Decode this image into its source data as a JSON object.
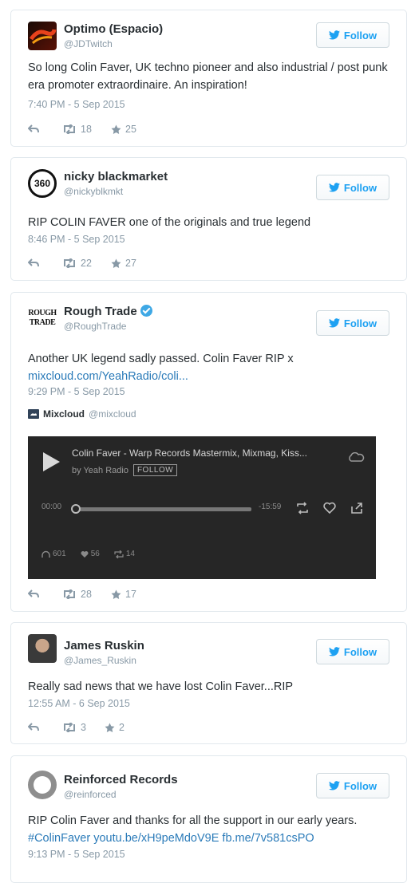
{
  "follow_label": "Follow",
  "tweets": [
    {
      "name": "Optimo (Espacio)",
      "handle": "@JDTwitch",
      "text": "So long Colin Faver, UK techno pioneer and also industrial / post punk era promoter extraordinaire. An inspiration!",
      "time": "7:40 PM - 5 Sep 2015",
      "retweets": "18",
      "favorites": "25"
    },
    {
      "name": "nicky blackmarket",
      "handle": "@nickyblkmkt",
      "avatar_text": "360",
      "text": "RIP COLIN FAVER one of the originals and true legend",
      "time": "8:46 PM - 5 Sep 2015",
      "retweets": "22",
      "favorites": "27"
    },
    {
      "name": "Rough Trade",
      "handle": "@RoughTrade",
      "avatar_text_1": "ROUGH",
      "avatar_text_2": "TRADE",
      "text": "Another UK legend sadly passed. Colin Faver RIP x",
      "link": "mixcloud.com/YeahRadio/coli...",
      "time": "9:29 PM - 5 Sep 2015",
      "card_source": "Mixcloud",
      "card_handle": "@mixcloud",
      "player": {
        "title": "Colin Faver - Warp Records Mastermix, Mixmag, Kiss...",
        "by": "by Yeah Radio",
        "follow": "FOLLOW",
        "start": "00:00",
        "end": "-15:59",
        "plays": "601",
        "likes": "56",
        "reposts": "14"
      },
      "retweets": "28",
      "favorites": "17"
    },
    {
      "name": "James Ruskin",
      "handle": "@James_Ruskin",
      "text": "Really sad news that we have lost Colin Faver...RIP",
      "time": "12:55 AM - 6 Sep 2015",
      "retweets": "3",
      "favorites": "2"
    },
    {
      "name": "Reinforced Records",
      "handle": "@reinforced",
      "text": "RIP Colin Faver and thanks for all the support in our early years.",
      "links": [
        "#ColinFaver",
        "youtu.be/xH9peMdoV9E",
        "fb.me/7v581csPO"
      ],
      "time": "9:13 PM - 5 Sep 2015"
    }
  ],
  "colors": {
    "link": "#2b7bb9",
    "follow": "#1da1f2",
    "meta": "#8899a6",
    "verified": "#3ea8e5"
  },
  "icons": [
    "reply-icon",
    "retweet-icon",
    "star-icon",
    "twitter-bird-icon",
    "verified-icon",
    "play-icon",
    "mixcloud-icon"
  ]
}
